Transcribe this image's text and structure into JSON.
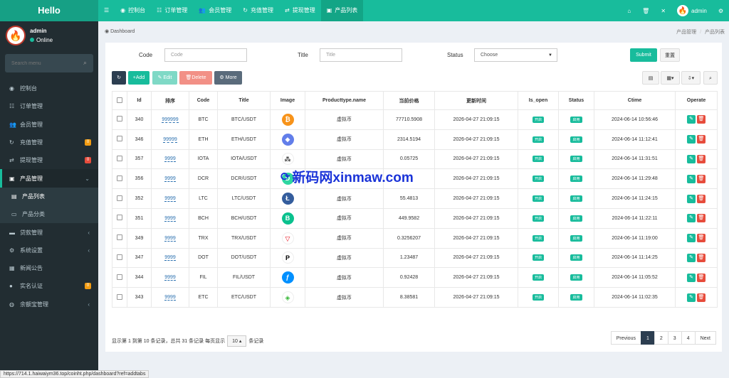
{
  "brand": "Hello",
  "nav": [
    "控制台",
    "订单管理",
    "会员管理",
    "充值管理",
    "提现管理",
    "产品列表"
  ],
  "nav_menu_icon": "menu-icon",
  "user": {
    "name": "admin",
    "status": "Online"
  },
  "search_placeholder": "Search menu",
  "sidebar": [
    {
      "label": "控制台",
      "icon": "dashboard-icon"
    },
    {
      "label": "订单管理",
      "icon": "list-icon"
    },
    {
      "label": "会员管理",
      "icon": "users-icon"
    },
    {
      "label": "充值管理",
      "icon": "recharge-icon",
      "badge": "0"
    },
    {
      "label": "提现管理",
      "icon": "withdraw-icon",
      "badge": "0"
    },
    {
      "label": "产品管理",
      "icon": "box-icon"
    },
    {
      "label": "产品列表",
      "icon": "product-list-icon"
    },
    {
      "label": "产品分类",
      "icon": "category-icon"
    },
    {
      "label": "贷款管理",
      "icon": "loan-icon"
    },
    {
      "label": "系统设置",
      "icon": "settings-icon"
    },
    {
      "label": "新闻公告",
      "icon": "news-icon"
    },
    {
      "label": "实名认证",
      "icon": "id-icon",
      "badge": "0"
    },
    {
      "label": "余额宝管理",
      "icon": "wallet-icon"
    }
  ],
  "breadcrumb": {
    "left": "Dashboard",
    "right1": "产品管理",
    "sep": "/",
    "right2": "产品列表"
  },
  "filters": {
    "code_label": "Code",
    "code_placeholder": "Code",
    "title_label": "Title",
    "title_placeholder": "Title",
    "status_label": "Status",
    "status_value": "Choose",
    "submit": "Submit",
    "reset": "重置"
  },
  "toolbar": {
    "add": "Add",
    "edit": "Edit",
    "delete": "Delete",
    "more": "More"
  },
  "columns": [
    "",
    "Id",
    "排序",
    "Code",
    "Title",
    "Image",
    "Producttype.name",
    "当前价格",
    "更新时间",
    "Is_open",
    "Status",
    "Ctime",
    "Operate"
  ],
  "rows": [
    {
      "id": "340",
      "order": "999999",
      "code": "BTC",
      "title": "BTC/USDT",
      "coin": "btc",
      "type": "虚拟币",
      "price": "77710.5908",
      "updated": "2026-04-27 21:09:15",
      "is_open": "开启",
      "status": "启用",
      "ctime": "2024-06-14 10:56:46"
    },
    {
      "id": "346",
      "order": "99999",
      "code": "ETH",
      "title": "ETH/USDT",
      "coin": "eth",
      "type": "虚拟币",
      "price": "2314.5194",
      "updated": "2026-04-27 21:09:15",
      "is_open": "开启",
      "status": "启用",
      "ctime": "2024-06-14 11:12:41"
    },
    {
      "id": "357",
      "order": "9999",
      "code": "IOTA",
      "title": "IOTA/USDT",
      "coin": "iota",
      "type": "虚拟币",
      "price": "0.05725",
      "updated": "2026-04-27 21:09:15",
      "is_open": "开启",
      "status": "启用",
      "ctime": "2024-06-14 11:31:51"
    },
    {
      "id": "356",
      "order": "9999",
      "code": "DCR",
      "title": "DCR/USDT",
      "coin": "dcr",
      "type": "",
      "price": "",
      "updated": "2026-04-27 21:09:15",
      "is_open": "开启",
      "status": "启用",
      "ctime": "2024-06-14 11:29:48"
    },
    {
      "id": "352",
      "order": "9999",
      "code": "LTC",
      "title": "LTC/USDT",
      "coin": "ltc",
      "type": "虚拟币",
      "price": "55.4813",
      "updated": "2026-04-27 21:09:15",
      "is_open": "开启",
      "status": "启用",
      "ctime": "2024-06-14 11:24:15"
    },
    {
      "id": "351",
      "order": "9999",
      "code": "BCH",
      "title": "BCH/USDT",
      "coin": "bch",
      "type": "虚拟币",
      "price": "449.9582",
      "updated": "2026-04-27 21:09:15",
      "is_open": "开启",
      "status": "启用",
      "ctime": "2024-06-14 11:22:11"
    },
    {
      "id": "349",
      "order": "9999",
      "code": "TRX",
      "title": "TRX/USDT",
      "coin": "trx",
      "type": "虚拟币",
      "price": "0.3256207",
      "updated": "2026-04-27 21:09:15",
      "is_open": "开启",
      "status": "启用",
      "ctime": "2024-06-14 11:19:00"
    },
    {
      "id": "347",
      "order": "9999",
      "code": "DOT",
      "title": "DOT/USDT",
      "coin": "dot",
      "type": "虚拟币",
      "price": "1.23487",
      "updated": "2026-04-27 21:09:15",
      "is_open": "开启",
      "status": "启用",
      "ctime": "2024-06-14 11:14:25"
    },
    {
      "id": "344",
      "order": "9999",
      "code": "FIL",
      "title": "FIL/USDT",
      "coin": "fil",
      "type": "虚拟币",
      "price": "0.92428",
      "updated": "2026-04-27 21:09:15",
      "is_open": "开启",
      "status": "启用",
      "ctime": "2024-06-14 11:05:52"
    },
    {
      "id": "343",
      "order": "9999",
      "code": "ETC",
      "title": "ETC/USDT",
      "coin": "etc",
      "type": "虚拟币",
      "price": "8.38581",
      "updated": "2026-04-27 21:09:15",
      "is_open": "开启",
      "status": "启用",
      "ctime": "2024-06-14 11:02:35"
    }
  ],
  "footer": {
    "summary": "显示第 1 到第 10 条记录，总共 31 条记录 每页显示",
    "page_size": "10",
    "suffix": "条记录"
  },
  "pager": [
    "Previous",
    "1",
    "2",
    "3",
    "4",
    "Next"
  ],
  "watermark": "新码网xinmaw.com",
  "status_url": "https://714.1.haiwaiym36.top/coinht.php/dashboard?ref=addtabs",
  "colors": {
    "topbar": "#18bc9c",
    "sidebar": "#222d32",
    "accent": "#18bc9c",
    "danger": "#e74c3c"
  }
}
